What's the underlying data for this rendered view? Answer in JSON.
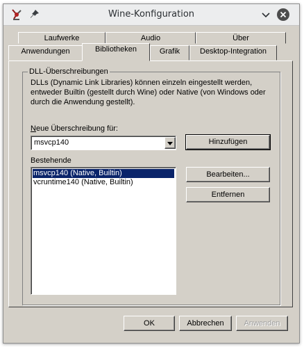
{
  "window": {
    "title": "Wine-Konfiguration"
  },
  "tabs_row1": [
    "Laufwerke",
    "Audio",
    "Über"
  ],
  "tabs_row2": [
    "Anwendungen",
    "Bibliotheken",
    "Grafik",
    "Desktop-Integration"
  ],
  "active_tab": "Bibliotheken",
  "group": {
    "label": "DLL-Überschreibungen",
    "description": "DLLs (Dynamic Link Libraries) können einzeln eingestellt werden, entweder Builtin (gestellt durch Wine) oder Native (von Windows oder durch die Anwendung gestellt).",
    "new_override_label": "Neue Überschreibung für:",
    "new_override_value": "msvcp140",
    "existing_label": "Bestehende",
    "existing": [
      "msvcp140 (Native, Builtin)",
      "vcruntime140 (Native, Builtin)"
    ],
    "selected_index": 0
  },
  "buttons": {
    "add": "Hinzufügen",
    "edit": "Bearbeiten...",
    "remove": "Entfernen",
    "ok": "OK",
    "cancel": "Abbrechen",
    "apply": "Anwenden"
  },
  "icons": {
    "app": "wine-glass-icon",
    "pin": "pin-icon",
    "minimize": "chevron-down-icon",
    "close": "close-icon"
  },
  "colors": {
    "selection": "#0a246a",
    "face": "#d4d0c8",
    "close_button": "#4d4d4d"
  }
}
